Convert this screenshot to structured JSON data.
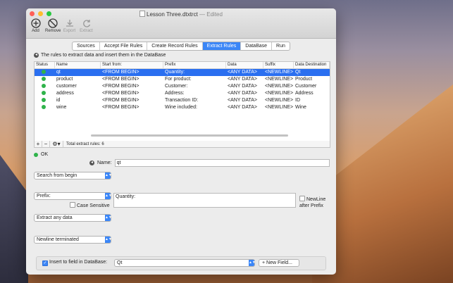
{
  "window": {
    "title": "Lesson Three.dtxtrct",
    "status": "— Edited"
  },
  "toolbar": [
    {
      "label": "Add",
      "icon": "add-icon",
      "enabled": true
    },
    {
      "label": "Remove",
      "icon": "remove-icon",
      "enabled": true
    },
    {
      "label": "Export",
      "icon": "export-icon",
      "enabled": false
    },
    {
      "label": "Extract",
      "icon": "extract-icon",
      "enabled": false
    }
  ],
  "tabs": [
    {
      "label": "Sources"
    },
    {
      "label": "Accept File Rules"
    },
    {
      "label": "Create Record Rules"
    },
    {
      "label": "Extract Rules",
      "active": true
    },
    {
      "label": "DataBase"
    },
    {
      "label": "Run"
    }
  ],
  "banner": "The rules to extract data and insert them in the DataBase",
  "table": {
    "headers": [
      "Status",
      "Name",
      "Start from:",
      "Prefix",
      "Data",
      "Suffix",
      "Data Destination"
    ],
    "rows": [
      [
        "qt",
        "<FROM BEGIN>",
        "Quantity:",
        "<ANY DATA>",
        "<NEWLINE>",
        "Qt"
      ],
      [
        "product",
        "<FROM BEGIN>",
        "For product:",
        "<ANY DATA>",
        "<NEWLINE>",
        "Product"
      ],
      [
        "customer",
        "<FROM BEGIN>",
        "Customer:",
        "<ANY DATA>",
        "<NEWLINE>",
        "Customer"
      ],
      [
        "address",
        "<FROM BEGIN>",
        "Address:",
        "<ANY DATA>",
        "<NEWLINE>",
        "Address"
      ],
      [
        "id",
        "<FROM BEGIN>",
        "Transaction ID:",
        "<ANY DATA>",
        "<NEWLINE>",
        "ID"
      ],
      [
        "wine",
        "<FROM BEGIN>",
        "Wine included:",
        "<ANY DATA>",
        "<NEWLINE>",
        "Wine"
      ]
    ],
    "footer": {
      "add": "+",
      "remove": "−",
      "total": "Total extract rules: 6"
    }
  },
  "status": {
    "text": "OK"
  },
  "detail": {
    "name_label": "Name:",
    "name_value": "qt",
    "start": "Search from begin",
    "prefix_mode": "Prefix:",
    "prefix_value": "Quantity:",
    "case_sensitive_label": "Case Sensitive",
    "newline_label": "NewLine after Prefix",
    "data_mode": "Extract any data",
    "suffix_mode": "Newline terminated",
    "insert_label": "Insert to field in DataBase:",
    "field_value": "Qt",
    "new_field": "New Field..."
  }
}
